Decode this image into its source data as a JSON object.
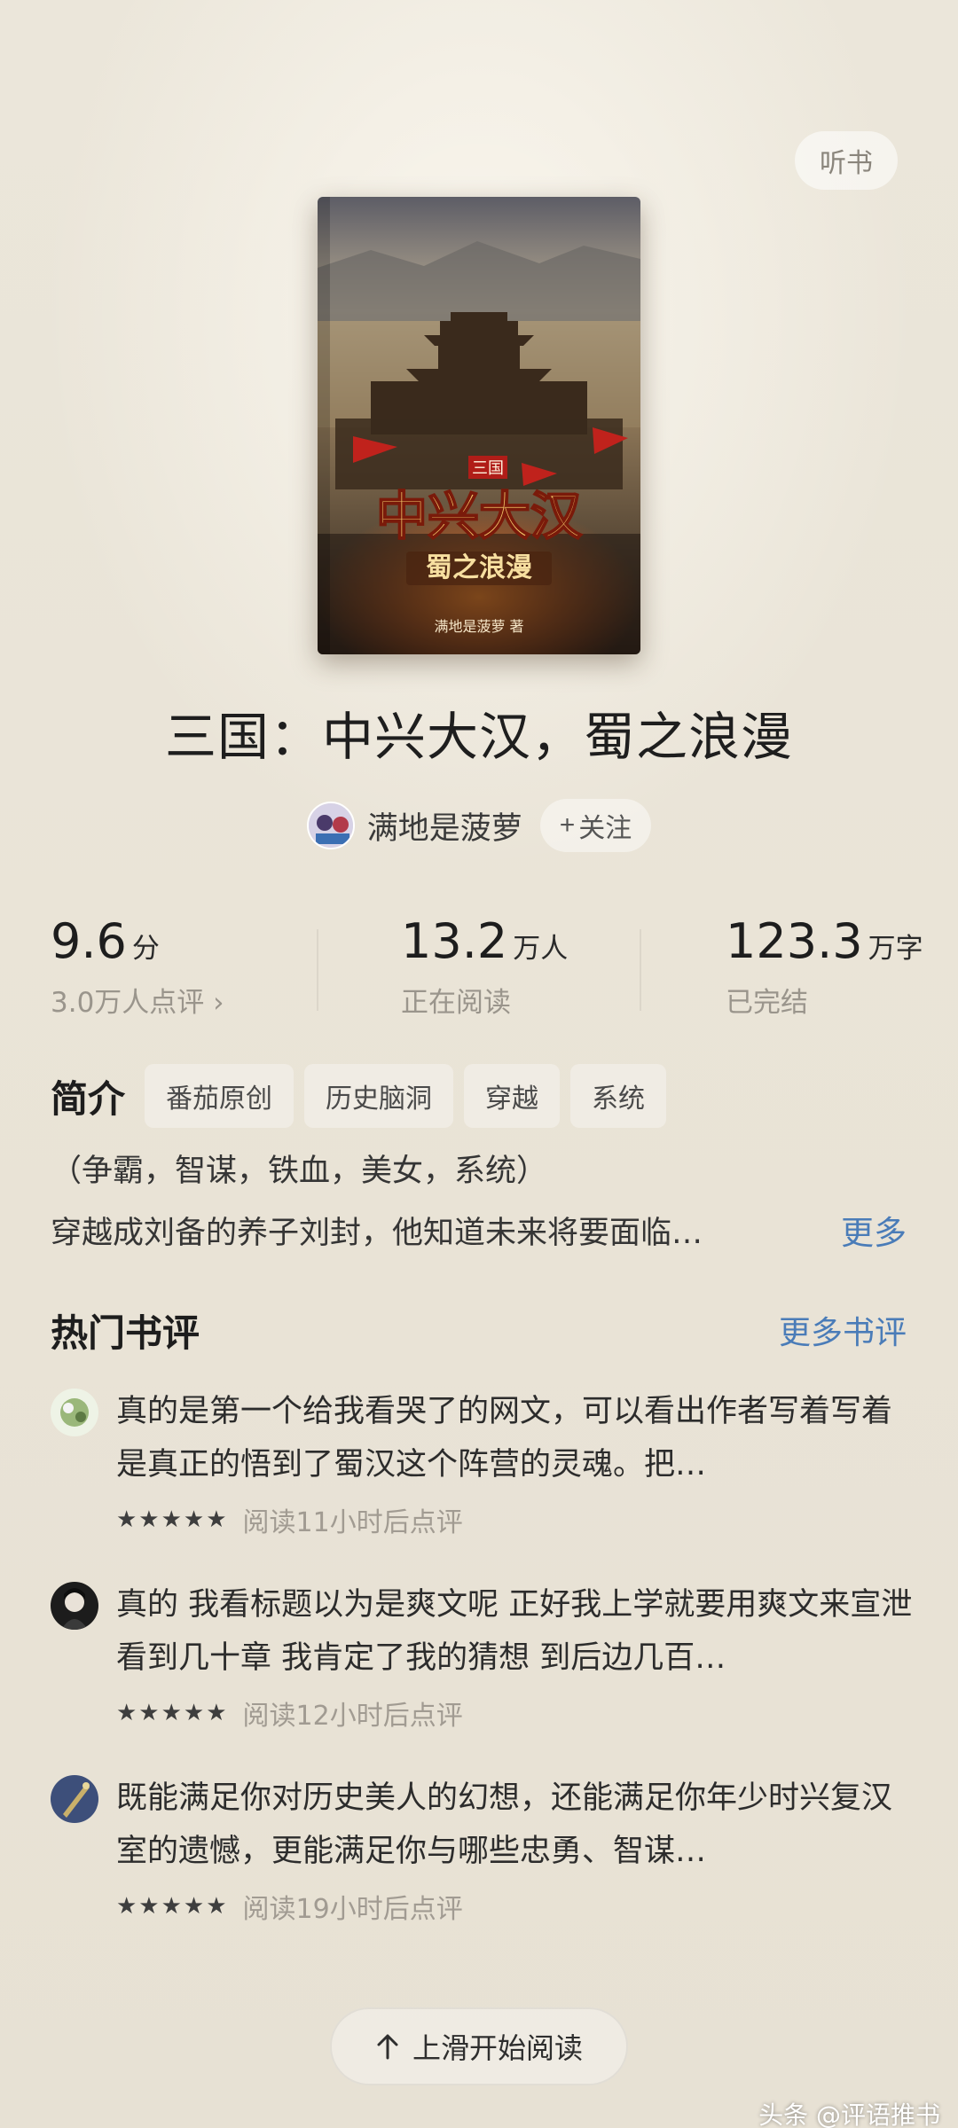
{
  "header": {
    "listen_label": "听书"
  },
  "book": {
    "title": "三国：中兴大汉，蜀之浪漫",
    "cover": {
      "series_mark": "三国",
      "main_title": "中兴大汉",
      "subtitle": "蜀之浪漫",
      "author_credit": "满地是菠萝 著"
    }
  },
  "author": {
    "name": "满地是菠萝",
    "follow_label": "关注",
    "follow_icon": "plus-icon"
  },
  "stats": [
    {
      "value": "9.6",
      "unit": "分",
      "sub": "3.0万人点评 ›"
    },
    {
      "value": "13.2",
      "unit": "万人",
      "sub": "正在阅读"
    },
    {
      "value": "123.3",
      "unit": "万字",
      "sub": "已完结"
    }
  ],
  "intro": {
    "label": "简介",
    "tags": [
      "番茄原创",
      "历史脑洞",
      "穿越",
      "系统"
    ],
    "line1": "（争霸，智谋，铁血，美女，系统）",
    "line2": "穿越成刘备的养子刘封，他知道未来将要面临…",
    "more_label": "更多"
  },
  "reviews_section": {
    "title": "热门书评",
    "more_label": "更多书评",
    "items": [
      {
        "text": "真的是第一个给我看哭了的网文，可以看出作者写着写着是真正的悟到了蜀汉这个阵营的灵魂。把…",
        "stars": "★★★★★",
        "time": "阅读11小时后点评"
      },
      {
        "text": "真的 我看标题以为是爽文呢 正好我上学就要用爽文来宣泄 看到几十章 我肯定了我的猜想 到后边几百…",
        "stars": "★★★★★",
        "time": "阅读12小时后点评"
      },
      {
        "text": "既能满足你对历史美人的幻想，还能满足你年少时兴复汉室的遗憾，更能满足你与哪些忠勇、智谋…",
        "stars": "★★★★★",
        "time": "阅读19小时后点评"
      }
    ]
  },
  "footer": {
    "start_label": "上滑开始阅读",
    "start_icon": "arrow-up-icon"
  },
  "watermark": "头条 @评语推书"
}
